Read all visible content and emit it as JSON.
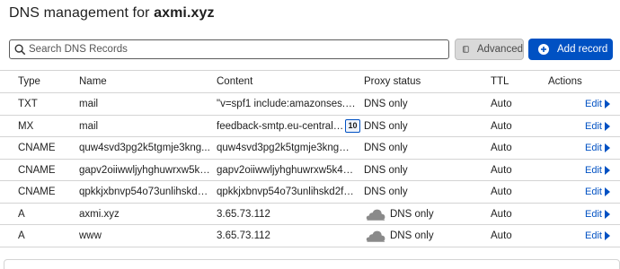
{
  "header": {
    "prefix": "DNS management for",
    "domain": "axmi.xyz"
  },
  "toolbar": {
    "search_placeholder": "Search DNS Records",
    "advanced_label": "Advanced",
    "add_record_label": "Add record",
    "accent_color": "#0051c3"
  },
  "table": {
    "columns": {
      "type": "Type",
      "name": "Name",
      "content": "Content",
      "proxy": "Proxy status",
      "ttl": "TTL",
      "actions": "Actions"
    },
    "rows": [
      {
        "type": "TXT",
        "name": "mail",
        "content": "\"v=spf1 include:amazonses.co...",
        "proxy": "DNS only",
        "ttl": "Auto",
        "action": "Edit"
      },
      {
        "type": "MX",
        "name": "mail",
        "content": "feedback-smtp.eu-central-1....",
        "badge": "10",
        "proxy": "DNS only",
        "ttl": "Auto",
        "action": "Edit"
      },
      {
        "type": "CNAME",
        "name": "quw4svd3pg2k5tgmje3kng...",
        "content": "quw4svd3pg2k5tgmje3kngmtb...",
        "proxy": "DNS only",
        "ttl": "Auto",
        "action": "Edit"
      },
      {
        "type": "CNAME",
        "name": "gapv2oiiwwljyhghuwrxw5k4...",
        "content": "gapv2oiiwwljyhghuwrxw5k45si...",
        "proxy": "DNS only",
        "ttl": "Auto",
        "action": "Edit"
      },
      {
        "type": "CNAME",
        "name": "qpkkjxbnvp54o73unlihskd2f...",
        "content": "qpkkjxbnvp54o73unlihskd2fq6...",
        "proxy": "DNS only",
        "ttl": "Auto",
        "action": "Edit"
      },
      {
        "type": "A",
        "name": "axmi.xyz",
        "content": "3.65.73.112",
        "proxy": "DNS only",
        "proxy_icon": "cloud-icon",
        "ttl": "Auto",
        "action": "Edit"
      },
      {
        "type": "A",
        "name": "www",
        "content": "3.65.73.112",
        "proxy": "DNS only",
        "proxy_icon": "cloud-icon",
        "ttl": "Auto",
        "action": "Edit"
      }
    ]
  }
}
